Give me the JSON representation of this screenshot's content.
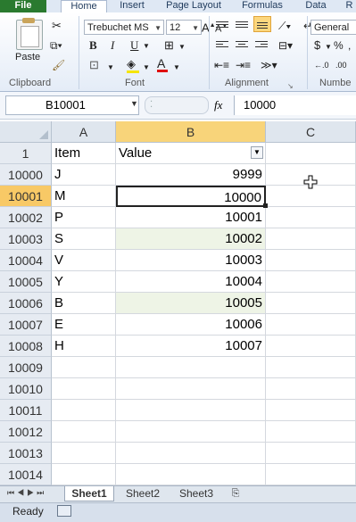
{
  "ribbon": {
    "tabs": [
      "File",
      "Home",
      "Insert",
      "Page Layout",
      "Formulas",
      "Data",
      "R"
    ],
    "clipboard_label": "Clipboard",
    "paste_label": "Paste",
    "font_label": "Font",
    "alignment_label": "Alignment",
    "number_label": "Numbe",
    "font_name": "Trebuchet MS",
    "font_size": "12",
    "number_format": "General",
    "bold": "B",
    "italic": "I",
    "underline": "U",
    "percent": "%",
    "dollar": "$",
    "grow": "A",
    "shrink": "A"
  },
  "formula_bar": {
    "name_box": "B10001",
    "fx": "fx",
    "content": "10000"
  },
  "columns": [
    "A",
    "B",
    "C"
  ],
  "header_row": {
    "num": "1",
    "a": "Item",
    "b": "Value"
  },
  "rows": [
    {
      "num": "10000",
      "a": "J",
      "b": "9999"
    },
    {
      "num": "10001",
      "a": "M",
      "b": "10000"
    },
    {
      "num": "10002",
      "a": "P",
      "b": "10001"
    },
    {
      "num": "10003",
      "a": "S",
      "b": "10002"
    },
    {
      "num": "10004",
      "a": "V",
      "b": "10003"
    },
    {
      "num": "10005",
      "a": "Y",
      "b": "10004"
    },
    {
      "num": "10006",
      "a": "B",
      "b": "10005"
    },
    {
      "num": "10007",
      "a": "E",
      "b": "10006"
    },
    {
      "num": "10008",
      "a": "H",
      "b": "10007"
    },
    {
      "num": "10009",
      "a": "",
      "b": ""
    },
    {
      "num": "10010",
      "a": "",
      "b": ""
    },
    {
      "num": "10011",
      "a": "",
      "b": ""
    },
    {
      "num": "10012",
      "a": "",
      "b": ""
    },
    {
      "num": "10013",
      "a": "",
      "b": ""
    },
    {
      "num": "10014",
      "a": "",
      "b": ""
    }
  ],
  "sheets": [
    "Sheet1",
    "Sheet2",
    "Sheet3"
  ],
  "status": "Ready"
}
